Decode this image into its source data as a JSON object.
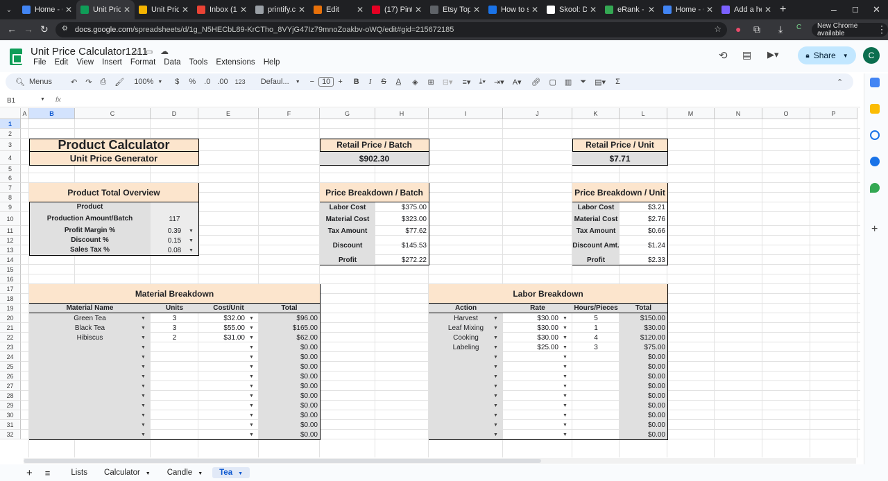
{
  "browser": {
    "tabs": [
      {
        "title": "Home - C",
        "color": "#4285f4"
      },
      {
        "title": "Unit Price",
        "color": "#0f9d58",
        "active": true
      },
      {
        "title": "Unit Price",
        "color": "#f4b400"
      },
      {
        "title": "Inbox (1,2",
        "color": "#ea4335"
      },
      {
        "title": "printify.co",
        "color": "#9aa0a6"
      },
      {
        "title": "Edit",
        "color": "#e8710a"
      },
      {
        "title": "(17) Pinte",
        "color": "#e60023"
      },
      {
        "title": "Etsy Top 1",
        "color": "#5f6368"
      },
      {
        "title": "How to sc",
        "color": "#1a73e8"
      },
      {
        "title": "Skool: Dis",
        "color": "#ffffff"
      },
      {
        "title": "eRank - K",
        "color": "#34a853"
      },
      {
        "title": "Home - C",
        "color": "#4285f4"
      },
      {
        "title": "Add a hea",
        "color": "#7b61ff"
      }
    ],
    "url_host": "docs.google.com",
    "url_path": "/spreadsheets/d/1g_N5HECbL89-KrCTho_8VYjG47Iz79mnoZoakbv-oWQ/edit#gid=215672185",
    "chrome_available": "New Chrome available",
    "profile": "C"
  },
  "doc": {
    "title": "Unit Price Calculator1211",
    "menu": [
      "File",
      "Edit",
      "View",
      "Insert",
      "Format",
      "Data",
      "Tools",
      "Extensions",
      "Help"
    ],
    "share_label": "Share",
    "avatar": "C"
  },
  "toolbar": {
    "menus": "Menus",
    "zoom": "100%",
    "currency": "$",
    "percent": "%",
    "dec_less": ".0",
    "dec_more": ".00",
    "format_num": "123",
    "font": "Defaul...",
    "font_size": "10",
    "bold": "B",
    "italic": "I",
    "strike": "S",
    "textcolor": "A",
    "sigma": "Σ"
  },
  "formula_bar": {
    "cell_ref": "B1",
    "fx": "fx",
    "value": ""
  },
  "grid": {
    "columns": [
      "A",
      "B",
      "C",
      "D",
      "E",
      "F",
      "G",
      "H",
      "I",
      "J",
      "K",
      "L",
      "M",
      "N",
      "O",
      "P"
    ],
    "rows": [
      "1",
      "2",
      "3",
      "4",
      "5",
      "6",
      "7",
      "8",
      "9",
      "10",
      "11",
      "12",
      "13",
      "14",
      "15",
      "16",
      "17",
      "18",
      "19",
      "20",
      "21",
      "22",
      "23",
      "24",
      "25",
      "26",
      "27",
      "28",
      "29",
      "30",
      "31",
      "32"
    ],
    "selected_col": "B",
    "selected_row": "1"
  },
  "calc": {
    "title": "Product Calculator",
    "subtitle": "Unit Price Generator",
    "overview_title": "Product Total Overview",
    "overview_rows": [
      {
        "label": "Product",
        "value": ""
      },
      {
        "label": "Production Amount/Batch",
        "value": "117"
      },
      {
        "label": "Profit Margin %",
        "value": "0.39"
      },
      {
        "label": "Discount %",
        "value": "0.15"
      },
      {
        "label": "Sales Tax %",
        "value": "0.08"
      }
    ],
    "retail_batch_title": "Retail Price / Batch",
    "retail_batch_value": "$902.30",
    "retail_unit_title": "Retail Price / Unit",
    "retail_unit_value": "$7.71",
    "breakdown_batch_title": "Price Breakdown / Batch",
    "breakdown_batch": [
      {
        "label": "Labor Cost",
        "value": "$375.00"
      },
      {
        "label": "Material Cost",
        "value": "$323.00"
      },
      {
        "label": "Tax Amount",
        "value": "$77.62"
      },
      {
        "label": "Discount",
        "value": "$145.53"
      },
      {
        "label": "Profit",
        "value": "$272.22"
      }
    ],
    "breakdown_unit_title": "Price Breakdown / Unit",
    "breakdown_unit": [
      {
        "label": "Labor Cost",
        "value": "$3.21"
      },
      {
        "label": "Material Cost",
        "value": "$2.76"
      },
      {
        "label": "Tax Amount",
        "value": "$0.66"
      },
      {
        "label": "Discount Amt.",
        "value": "$1.24"
      },
      {
        "label": "Profit",
        "value": "$2.33"
      }
    ],
    "material_title": "Material Breakdown",
    "material_headers": [
      "Material Name",
      "Units",
      "Cost/Unit",
      "Total"
    ],
    "material_rows": [
      [
        "Green Tea",
        "3",
        "$32.00",
        "$96.00"
      ],
      [
        "Black Tea",
        "3",
        "$55.00",
        "$165.00"
      ],
      [
        "Hibiscus",
        "2",
        "$31.00",
        "$62.00"
      ],
      [
        "",
        "",
        "",
        "$0.00"
      ],
      [
        "",
        "",
        "",
        "$0.00"
      ],
      [
        "",
        "",
        "",
        "$0.00"
      ],
      [
        "",
        "",
        "",
        "$0.00"
      ],
      [
        "",
        "",
        "",
        "$0.00"
      ],
      [
        "",
        "",
        "",
        "$0.00"
      ],
      [
        "",
        "",
        "",
        "$0.00"
      ],
      [
        "",
        "",
        "",
        "$0.00"
      ],
      [
        "",
        "",
        "",
        "$0.00"
      ],
      [
        "",
        "",
        "",
        "$0.00"
      ]
    ],
    "labor_title": "Labor Breakdown",
    "labor_headers": [
      "Action",
      "Rate",
      "Hours/Pieces",
      "Total"
    ],
    "labor_rows": [
      [
        "Harvest",
        "$30.00",
        "5",
        "$150.00"
      ],
      [
        "Leaf Mixing",
        "$30.00",
        "1",
        "$30.00"
      ],
      [
        "Cooking",
        "$30.00",
        "4",
        "$120.00"
      ],
      [
        "Labeling",
        "$25.00",
        "3",
        "$75.00"
      ],
      [
        "",
        "",
        "",
        "$0.00"
      ],
      [
        "",
        "",
        "",
        "$0.00"
      ],
      [
        "",
        "",
        "",
        "$0.00"
      ],
      [
        "",
        "",
        "",
        "$0.00"
      ],
      [
        "",
        "",
        "",
        "$0.00"
      ],
      [
        "",
        "",
        "",
        "$0.00"
      ],
      [
        "",
        "",
        "",
        "$0.00"
      ],
      [
        "",
        "",
        "",
        "$0.00"
      ],
      [
        "",
        "",
        "",
        "$0.00"
      ]
    ]
  },
  "sheets": {
    "tabs": [
      "Lists",
      "Calculator",
      "Candle",
      "Tea"
    ],
    "active": "Tea"
  }
}
